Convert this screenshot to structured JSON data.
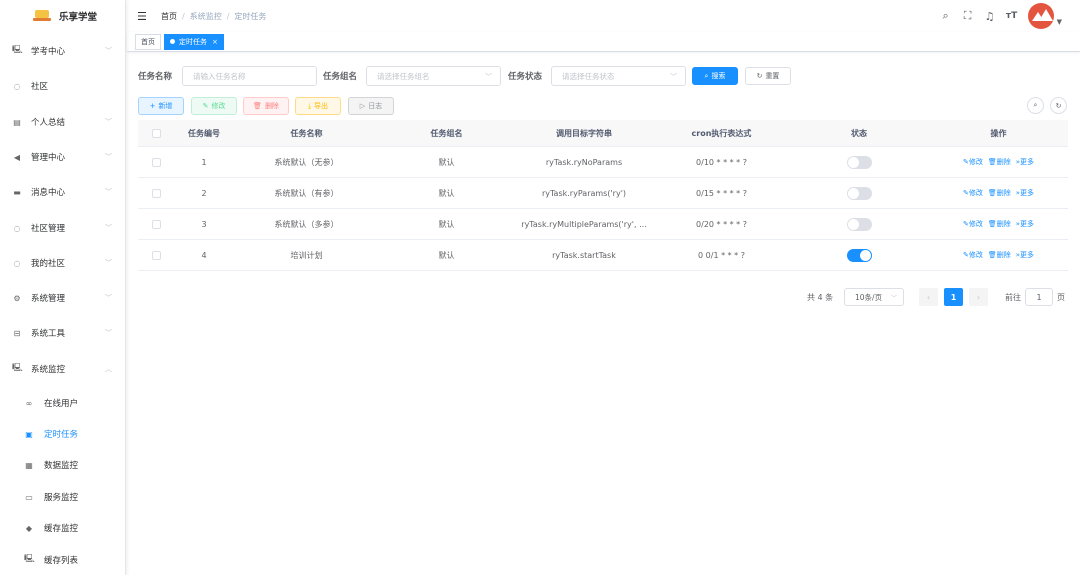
{
  "app": {
    "title": "乐享学堂"
  },
  "sidebar": {
    "items": [
      {
        "label": "学考中心",
        "icon": "monitor-icon",
        "glyph": "🖳",
        "arrow": "﹀"
      },
      {
        "label": "社区",
        "icon": "circle-icon",
        "glyph": "◌",
        "arrow": ""
      },
      {
        "label": "个人总结",
        "icon": "clipboard-icon",
        "glyph": "▤",
        "arrow": "﹀"
      },
      {
        "label": "管理中心",
        "icon": "send-icon",
        "glyph": "◀",
        "arrow": "﹀"
      },
      {
        "label": "消息中心",
        "icon": "message-icon",
        "glyph": "▬",
        "arrow": "﹀"
      },
      {
        "label": "社区管理",
        "icon": "circle-icon",
        "glyph": "◌",
        "arrow": "﹀"
      },
      {
        "label": "我的社区",
        "icon": "circle-icon",
        "glyph": "◌",
        "arrow": "﹀"
      },
      {
        "label": "系统管理",
        "icon": "settings-icon",
        "glyph": "⚙",
        "arrow": "﹀"
      },
      {
        "label": "系统工具",
        "icon": "toolbox-icon",
        "glyph": "⊟",
        "arrow": "﹀"
      },
      {
        "label": "系统监控",
        "icon": "monitor-icon",
        "glyph": "🖳",
        "arrow": "︿"
      }
    ],
    "sub_items": [
      {
        "label": "在线用户",
        "icon": "online-icon",
        "glyph": "∞",
        "active": false
      },
      {
        "label": "定时任务",
        "icon": "job-icon",
        "glyph": "▣",
        "active": true
      },
      {
        "label": "数据监控",
        "icon": "database-icon",
        "glyph": "▦",
        "active": false
      },
      {
        "label": "服务监控",
        "icon": "server-icon",
        "glyph": "▭",
        "active": false
      },
      {
        "label": "缓存监控",
        "icon": "redis-icon",
        "glyph": "◆",
        "active": false
      },
      {
        "label": "缓存列表",
        "icon": "cache-list-icon",
        "glyph": "🖳",
        "active": false
      }
    ]
  },
  "header": {
    "breadcrumb": [
      "首页",
      "系统监控",
      "定时任务"
    ],
    "icons": [
      {
        "name": "search-icon",
        "glyph": "🔍"
      },
      {
        "name": "fullscreen-icon",
        "glyph": "⛶"
      },
      {
        "name": "bell-icon",
        "glyph": "🔔"
      },
      {
        "name": "font-size-icon",
        "glyph": "тT"
      }
    ]
  },
  "tags": {
    "home": "首页",
    "current": "定时任务",
    "close": "×"
  },
  "search": {
    "job_name_label": "任务名称",
    "job_name_placeholder": "请输入任务名称",
    "job_group_label": "任务组名",
    "job_group_placeholder": "请选择任务组名",
    "status_label": "任务状态",
    "status_placeholder": "请选择任务状态",
    "search_button": "搜索",
    "reset_button": "重置"
  },
  "toolbar": {
    "add": "新增",
    "edit": "修改",
    "delete": "删除",
    "export": "导出",
    "log": "日志"
  },
  "table": {
    "columns": [
      "任务编号",
      "任务名称",
      "任务组名",
      "调用目标字符串",
      "cron执行表达式",
      "状态",
      "操作"
    ],
    "rows": [
      {
        "id": "1",
        "name": "系统默认（无参）",
        "group": "默认",
        "target": "ryTask.ryNoParams",
        "cron": "0/10 * * * * ?",
        "status_on": false
      },
      {
        "id": "2",
        "name": "系统默认（有参）",
        "group": "默认",
        "target": "ryTask.ryParams('ry')",
        "cron": "0/15 * * * * ?",
        "status_on": false
      },
      {
        "id": "3",
        "name": "系统默认（多参）",
        "group": "默认",
        "target": "ryTask.ryMultipleParams('ry', ...",
        "cron": "0/20 * * * * ?",
        "status_on": false
      },
      {
        "id": "4",
        "name": "培训计划",
        "group": "默认",
        "target": "ryTask.startTask",
        "cron": "0 0/1 * * * ?",
        "status_on": true
      }
    ],
    "ops": {
      "edit": "修改",
      "delete": "删除",
      "more": "更多"
    }
  },
  "pagination": {
    "total": "共 4 条",
    "page_size": "10条/页",
    "current_page": "1",
    "goto_label": "前往",
    "goto_value": "1",
    "page_suffix": "页"
  },
  "colors": {
    "primary": "#1890ff",
    "avatar": "#e4553f"
  }
}
